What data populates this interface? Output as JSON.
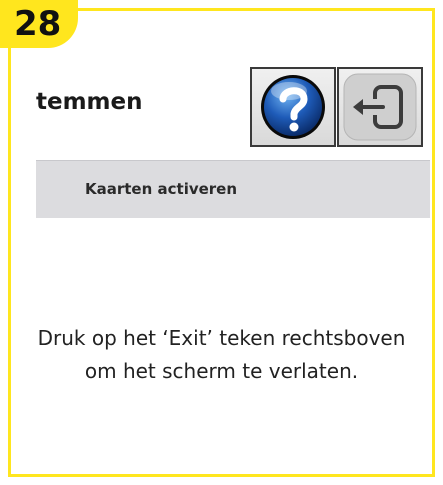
{
  "step": {
    "number": "28"
  },
  "window": {
    "title_partial": "temmen"
  },
  "toolbar": {
    "help_icon": "question-mark-icon",
    "exit_icon": "exit-door-arrow-icon"
  },
  "tab": {
    "label": "Kaarten activeren"
  },
  "instruction": {
    "text": "Druk op het ‘Exit’ teken rechtsboven om het scherm te verlaten."
  },
  "colors": {
    "frame_accent": "#FFE61E",
    "help_blue": "#1E5BB8",
    "tab_bar": "#DCDCDF"
  }
}
